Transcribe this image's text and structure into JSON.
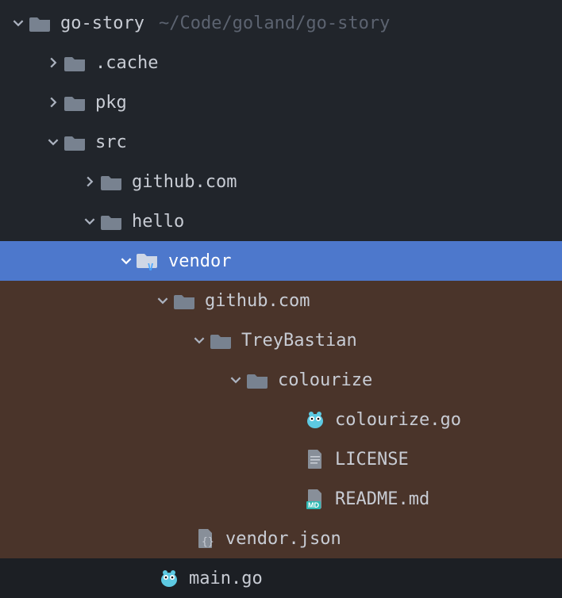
{
  "root": {
    "name": "go-story",
    "path_hint": "~/Code/goland/go-story"
  },
  "nodes": {
    "cache": ".cache",
    "pkg": "pkg",
    "src": "src",
    "github1": "github.com",
    "hello": "hello",
    "vendor": "vendor",
    "github2": "github.com",
    "trey": "TreyBastian",
    "colourize": "colourize",
    "colourize_go": "colourize.go",
    "license": "LICENSE",
    "readme": "README.md",
    "vendor_json": "vendor.json",
    "main_go": "main.go"
  }
}
